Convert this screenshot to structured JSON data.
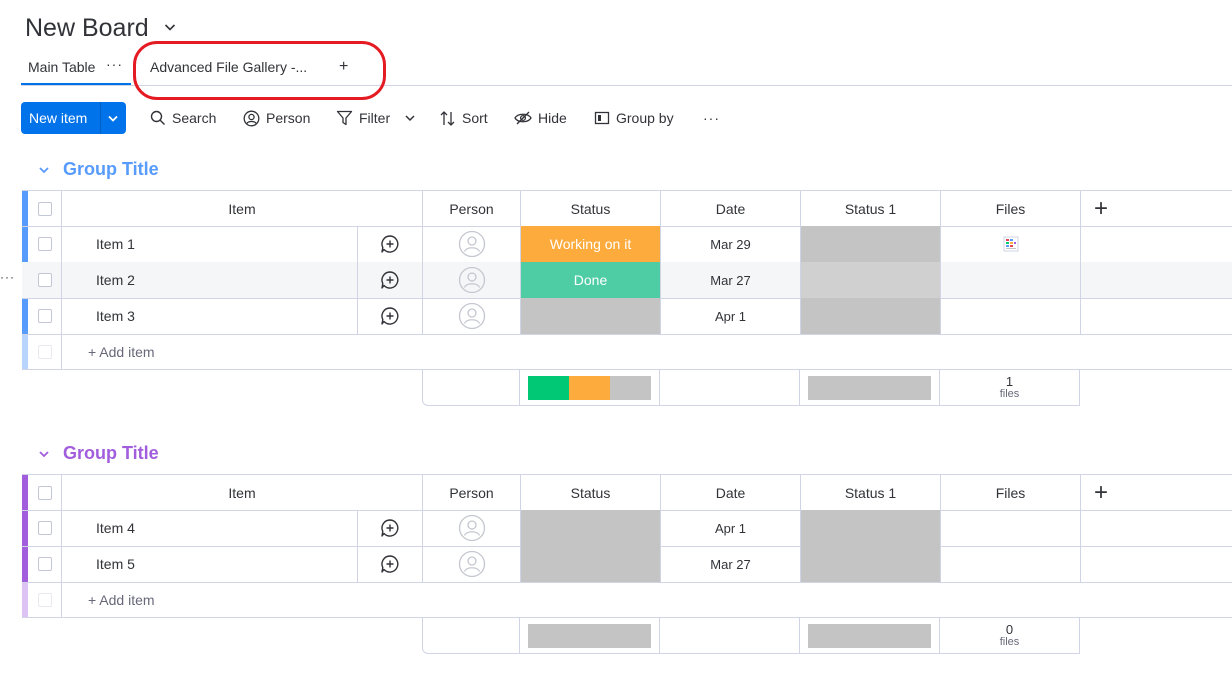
{
  "header": {
    "title": "New Board",
    "tabs": [
      {
        "label": "Main Table",
        "menu": "···"
      },
      {
        "label": "Advanced File Gallery -..."
      }
    ],
    "add_view": "+"
  },
  "toolbar": {
    "new_item": "New item",
    "search": "Search",
    "person": "Person",
    "filter": "Filter",
    "sort": "Sort",
    "hide": "Hide",
    "group_by": "Group by",
    "more": "···"
  },
  "row_menu": "···",
  "columns": [
    "Item",
    "Person",
    "Status",
    "Date",
    "Status 1",
    "Files"
  ],
  "add_column": "+",
  "groups": [
    {
      "title": "Group Title",
      "color": "#579bfc",
      "strip_color": "#579bfc",
      "items": [
        {
          "name": "Item 1",
          "status": "Working on it",
          "status_color": "#fdab3d",
          "date": "Mar 29",
          "status1_color": "#c4c4c4",
          "has_file": true
        },
        {
          "name": "Item 2",
          "status": "Done",
          "status_color": "#4eccA4",
          "date": "Mar 27",
          "status1_color": "#d0d0d0",
          "has_file": false
        },
        {
          "name": "Item 3",
          "status": "",
          "status_color": "#c4c4c4",
          "date": "Apr 1",
          "status1_color": "#c4c4c4",
          "has_file": false
        }
      ],
      "add_item": "+ Add item",
      "summary": {
        "status_distribution": [
          {
            "color": "#00c875",
            "fraction": 0.333
          },
          {
            "color": "#fdab3d",
            "fraction": 0.333
          },
          {
            "color": "#c4c4c4",
            "fraction": 0.334
          }
        ],
        "files_count": "1",
        "files_label": "files"
      }
    },
    {
      "title": "Group Title",
      "color": "#a25ddc",
      "strip_color": "#a25ddc",
      "items": [
        {
          "name": "Item 4",
          "status": "",
          "status_color": "#c4c4c4",
          "date": "Apr 1",
          "status1_color": "#c4c4c4",
          "has_file": false
        },
        {
          "name": "Item 5",
          "status": "",
          "status_color": "#c4c4c4",
          "date": "Mar 27",
          "status1_color": "#c4c4c4",
          "has_file": false
        }
      ],
      "add_item": "+ Add item",
      "summary": {
        "status_distribution": [
          {
            "color": "#c4c4c4",
            "fraction": 1.0
          }
        ],
        "files_count": "0",
        "files_label": "files"
      }
    }
  ]
}
